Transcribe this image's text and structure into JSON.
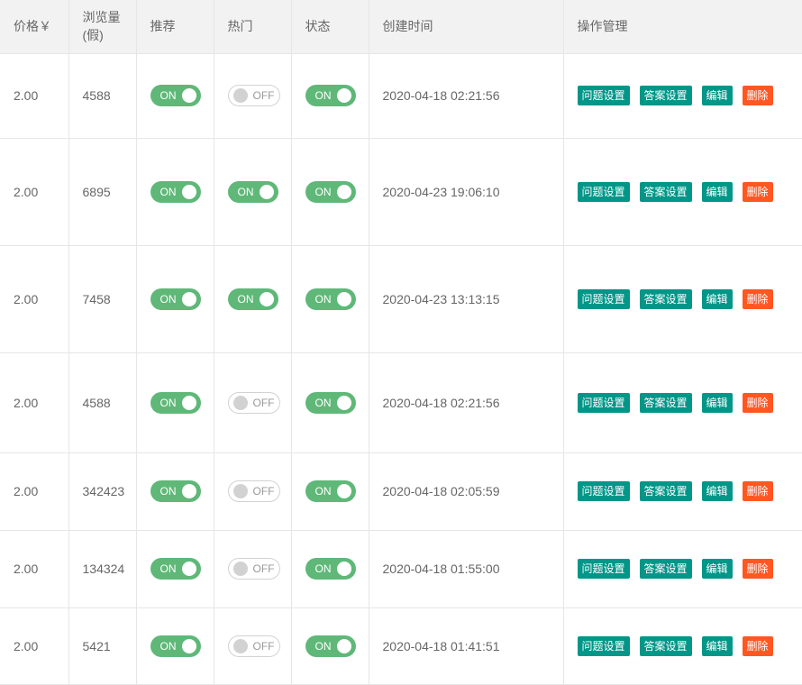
{
  "headers": [
    "价格￥",
    "浏览量(假)",
    "推荐",
    "热门",
    "状态",
    "创建时间",
    "操作管理"
  ],
  "actions": {
    "question": "问题设置",
    "answer": "答案设置",
    "edit": "编辑",
    "delete": "删除"
  },
  "switch_labels": {
    "on": "ON",
    "off": "OFF"
  },
  "rows": [
    {
      "price": "2.00",
      "views": "4588",
      "recommend": true,
      "hot": false,
      "status": true,
      "created": "2020-04-18 02:21:56"
    },
    {
      "price": "2.00",
      "views": "6895",
      "recommend": true,
      "hot": true,
      "status": true,
      "created": "2020-04-23 19:06:10"
    },
    {
      "price": "2.00",
      "views": "7458",
      "recommend": true,
      "hot": true,
      "status": true,
      "created": "2020-04-23 13:13:15"
    },
    {
      "price": "2.00",
      "views": "4588",
      "recommend": true,
      "hot": false,
      "status": true,
      "created": "2020-04-18 02:21:56"
    },
    {
      "price": "2.00",
      "views": "342423",
      "recommend": true,
      "hot": false,
      "status": true,
      "created": "2020-04-18 02:05:59"
    },
    {
      "price": "2.00",
      "views": "134324",
      "recommend": true,
      "hot": false,
      "status": true,
      "created": "2020-04-18 01:55:00"
    },
    {
      "price": "2.00",
      "views": "5421",
      "recommend": true,
      "hot": false,
      "status": true,
      "created": "2020-04-18 01:41:51"
    }
  ]
}
